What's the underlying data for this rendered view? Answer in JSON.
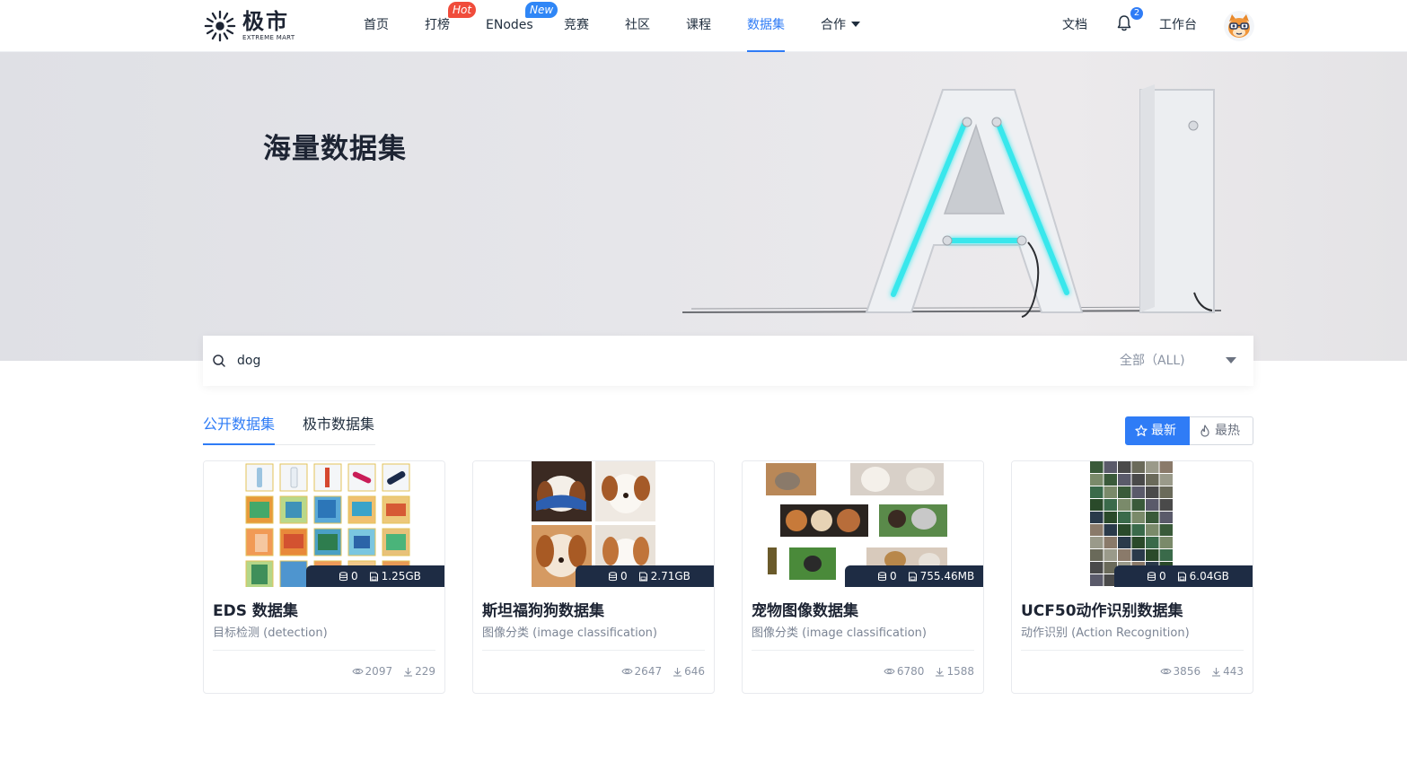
{
  "brand": {
    "name_cn": "极市",
    "name_en": "EXTREME MART"
  },
  "nav": {
    "home": "首页",
    "rank": "打榜",
    "rank_badge": "Hot",
    "enodes": "ENodes",
    "enodes_badge": "New",
    "contest": "竞赛",
    "community": "社区",
    "course": "课程",
    "dataset": "数据集",
    "partner": "合作",
    "docs": "文档",
    "notifications": "2",
    "workbench": "工作台"
  },
  "banner": {
    "title": "海量数据集"
  },
  "search": {
    "query": "dog",
    "scope": "全部（ALL)"
  },
  "tabs": {
    "public": "公开数据集",
    "mart": "极市数据集"
  },
  "sort": {
    "newest": "最新",
    "hottest": "最热"
  },
  "colors": {
    "accent": "#2f7cf6",
    "stats_bar": "#1e2c44",
    "hot_badge": "#f04c3b"
  },
  "cards": [
    {
      "title": "EDS 数据集",
      "category": "目标检测 (detection)",
      "versions": "0",
      "size": "1.25GB",
      "views": "2097",
      "downloads": "229"
    },
    {
      "title": "斯坦福狗狗数据集",
      "category": "图像分类 (image classification)",
      "versions": "0",
      "size": "2.71GB",
      "views": "2647",
      "downloads": "646"
    },
    {
      "title": "宠物图像数据集",
      "category": "图像分类 (image classification)",
      "versions": "0",
      "size": "755.46MB",
      "views": "6780",
      "downloads": "1588"
    },
    {
      "title": "UCF50动作识别数据集",
      "category": "动作识别 (Action Recognition)",
      "versions": "0",
      "size": "6.04GB",
      "views": "3856",
      "downloads": "443"
    }
  ]
}
